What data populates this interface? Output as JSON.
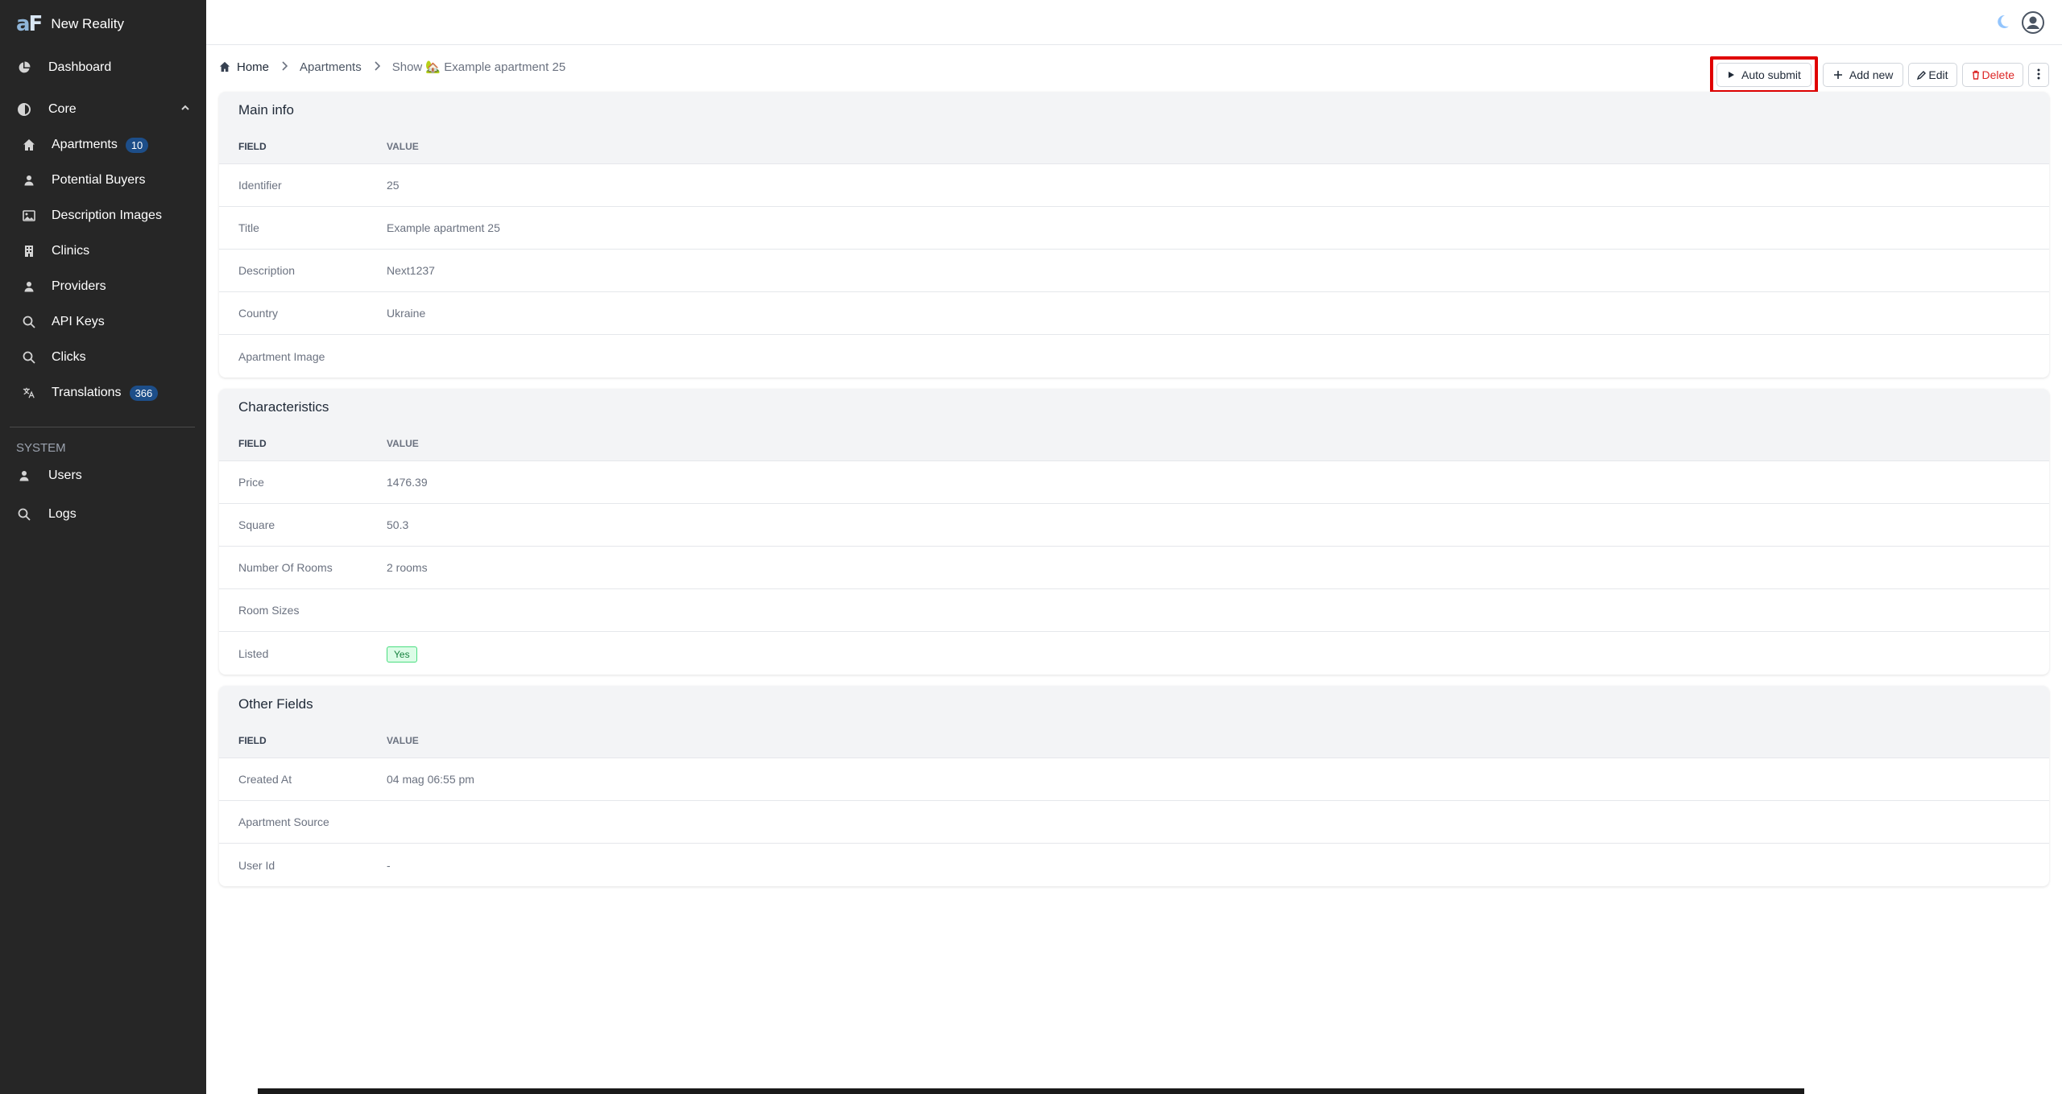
{
  "app": {
    "name": "New Reality",
    "logo_text": "aF"
  },
  "sidebar": {
    "items": [
      {
        "label": "Dashboard",
        "icon": "chart-pie-icon"
      },
      {
        "label": "Core",
        "icon": "half-circle-icon"
      }
    ],
    "core_items": [
      {
        "label": "Apartments",
        "icon": "home-icon",
        "badge": "10"
      },
      {
        "label": "Potential Buyers",
        "icon": "user-icon"
      },
      {
        "label": "Description Images",
        "icon": "image-icon"
      },
      {
        "label": "Clinics",
        "icon": "building-icon"
      },
      {
        "label": "Providers",
        "icon": "user-icon"
      },
      {
        "label": "API Keys",
        "icon": "search-icon"
      },
      {
        "label": "Clicks",
        "icon": "search-icon"
      },
      {
        "label": "Translations",
        "icon": "translate-icon",
        "badge": "366"
      }
    ],
    "system_label": "SYSTEM",
    "system_items": [
      {
        "label": "Users",
        "icon": "user-icon"
      },
      {
        "label": "Logs",
        "icon": "search-icon"
      }
    ]
  },
  "breadcrumb": {
    "home": "Home",
    "apartments": "Apartments",
    "current": "Show 🏡 Example apartment 25"
  },
  "actions": {
    "auto_submit": "Auto submit",
    "add_new": "Add new",
    "edit": "Edit",
    "delete": "Delete"
  },
  "sections": {
    "main": {
      "title": "Main info",
      "field_header": "FIELD",
      "value_header": "VALUE",
      "rows": [
        {
          "field": "Identifier",
          "value": "25"
        },
        {
          "field": "Title",
          "value": "Example apartment 25"
        },
        {
          "field": "Description",
          "value": "Next1237"
        },
        {
          "field": "Country",
          "value": "Ukraine"
        },
        {
          "field": "Apartment Image",
          "value": ""
        }
      ]
    },
    "characteristics": {
      "title": "Characteristics",
      "field_header": "FIELD",
      "value_header": "VALUE",
      "rows": [
        {
          "field": "Price",
          "value": "1476.39"
        },
        {
          "field": "Square",
          "value": "50.3"
        },
        {
          "field": "Number Of Rooms",
          "value": "2 rooms"
        },
        {
          "field": "Room Sizes",
          "value": ""
        },
        {
          "field": "Listed",
          "value": "Yes"
        }
      ]
    },
    "other": {
      "title": "Other Fields",
      "field_header": "FIELD",
      "value_header": "VALUE",
      "rows": [
        {
          "field": "Created At",
          "value": "04 mag 06:55 pm"
        },
        {
          "field": "Apartment Source",
          "value": ""
        },
        {
          "field": "User Id",
          "value": "-"
        }
      ]
    }
  },
  "colors": {
    "sidebar_bg": "#262626",
    "badge_bg": "#1d4e89",
    "highlight": "#e00000",
    "delete": "#dc2626",
    "yes_bg": "#dcfce7"
  }
}
